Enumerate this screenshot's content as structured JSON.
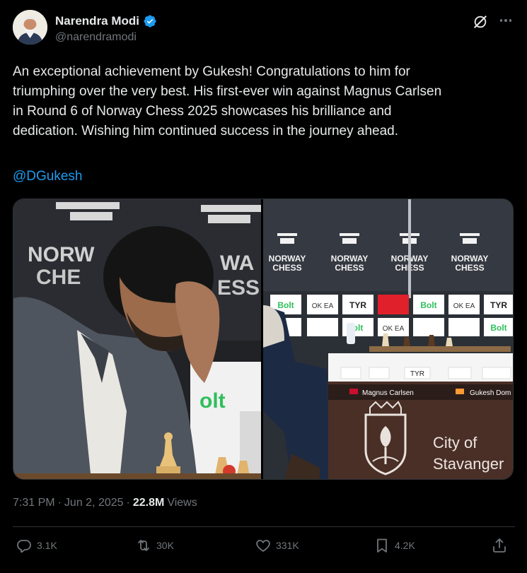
{
  "author": {
    "display_name": "Narendra Modi",
    "handle": "@narendramodi",
    "verified": true
  },
  "tweet": {
    "text": "An exceptional achievement by Gukesh! Congratulations to him for\ntriumphing over the very best. His first-ever win against Magnus Carlsen\nin Round 6 of Norway Chess 2025 showcases his brilliance and\ndedication. Wishing him continued success in the journey ahead.",
    "mention": "@DGukesh"
  },
  "media": {
    "left_photo": {
      "logo_text_1": "NORW",
      "logo_text_2": "CHE",
      "logo_text_3": "WA",
      "logo_text_4": "ESS",
      "sponsor": "olt"
    },
    "right_photo": {
      "logos": [
        "NORWAY CHESS",
        "NORWAY CHESS",
        "NORWAY CHESS",
        "NORWAY CHESS"
      ],
      "sponsors_row1": [
        "Bolt",
        "OK EA",
        "TYR",
        "",
        "Bolt",
        "OK EA",
        "TYR"
      ],
      "player_left": "Magnus Carlsen",
      "player_right": "Gukesh Dom",
      "city_line1": "City of",
      "city_line2": "Stavanger"
    }
  },
  "meta": {
    "time": "7:31 PM",
    "separator": "·",
    "date": "Jun 2, 2025",
    "views_count": "22.8M",
    "views_label": "Views"
  },
  "actions": {
    "replies": "3.1K",
    "reposts": "30K",
    "likes": "331K",
    "bookmarks": "4.2K"
  },
  "colors": {
    "background": "#000000",
    "text": "#e7e9ea",
    "muted": "#71767b",
    "link": "#1d9bf0",
    "verified": "#1d9bf0",
    "divider": "#2f3336"
  }
}
